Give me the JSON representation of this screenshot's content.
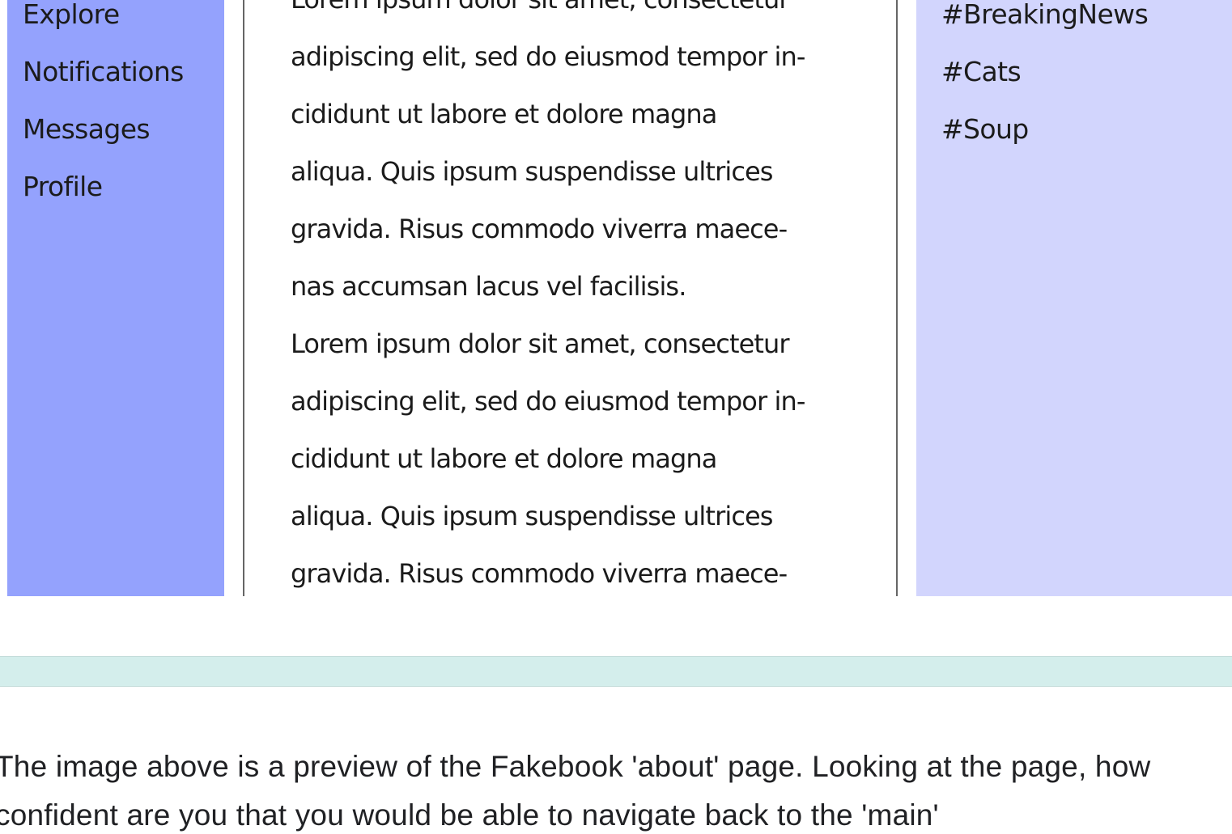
{
  "nav": {
    "items": [
      {
        "label": "Explore"
      },
      {
        "label": "Notifications"
      },
      {
        "label": "Messages"
      },
      {
        "label": "Profile"
      }
    ]
  },
  "feed": {
    "lines": [
      "Lorem ipsum dolor sit amet, consectetur",
      "adipiscing elit, sed do eiusmod tempor in-",
      "cididunt ut labore et dolore magna",
      "aliqua. Quis ipsum suspendisse ultrices",
      "gravida. Risus commodo viverra maece-",
      "nas accumsan lacus vel facilisis.",
      "Lorem ipsum dolor sit amet, consectetur",
      "adipiscing elit, sed do eiusmod tempor in-",
      "cididunt ut labore et dolore magna",
      "aliqua. Quis ipsum suspendisse ultrices",
      "gravida. Risus commodo viverra maece-"
    ]
  },
  "trends": {
    "items": [
      {
        "label": "#BreakingNews"
      },
      {
        "label": "#Cats"
      },
      {
        "label": "#Soup"
      }
    ]
  },
  "survey": {
    "question": "The image above is a preview of the Fakebook 'about' page. Looking at the page, how confident are you that you would be able to navigate back to the 'main'"
  },
  "colors": {
    "nav_bg": "#94a2fd",
    "trends_bg": "#d2d5fd",
    "divider_bg": "#d4eeec"
  }
}
